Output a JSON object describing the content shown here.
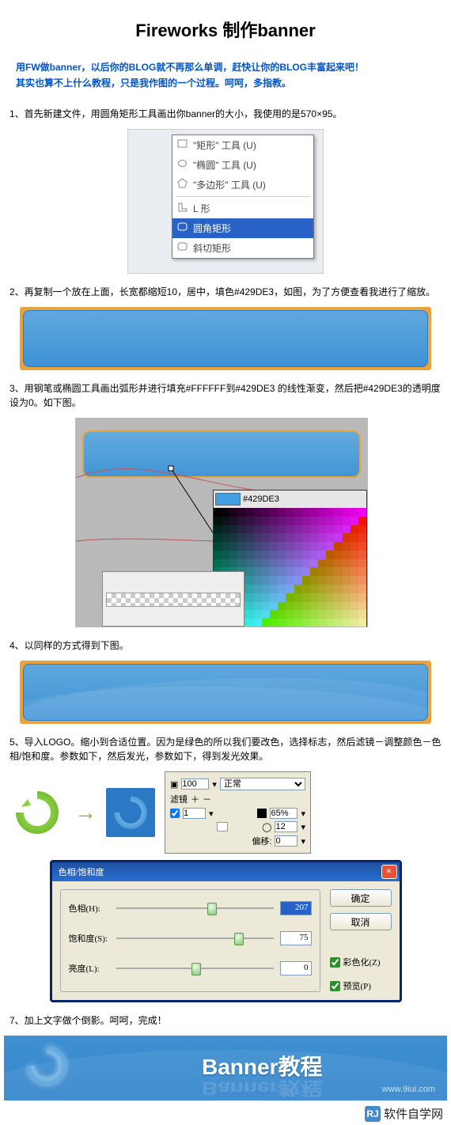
{
  "title": "Fireworks 制作banner",
  "intro": {
    "line1": "用FW做banner，以后你的BLOG就不再那么单调，赶快让你的BLOG丰富起来吧！",
    "line2": "其实也算不上什么教程，只是我作图的一个过程。呵呵，多指教。"
  },
  "steps": {
    "s1": "1、首先新建文件，用圆角矩形工具画出你banner的大小，我使用的是570×95。",
    "s2": "2、再复制一个放在上面，长宽都缩短10，居中，填色#429DE3，如图，为了方便查看我进行了缩放。",
    "s3": "3、用钢笔或椭圆工具画出弧形并进行填充#FFFFFF到#429DE3 的线性渐变，然后把#429DE3的透明度设为0。如下图。",
    "s4": "4、以同样的方式得到下图。",
    "s5": "5、导入LOGO。缩小到合适位置。因为是绿色的所以我们要改色，选择标志，然后滤镜－调整颜色－色相/饱和度。参数如下，然后发光，参数如下，得到发光效果。",
    "s7": "7、加上文字做个倒影。呵呵，完成！"
  },
  "menu": {
    "m1": "\"矩形\" 工具  (U)",
    "m2": "\"椭圆\" 工具  (U)",
    "m3": "\"多边形\" 工具  (U)",
    "m4": "L 形",
    "m5": "圆角矩形",
    "m6": "斜切矩形"
  },
  "hexcolor": "#429DE3",
  "panel5": {
    "opacity": "100",
    "blend": "正常",
    "filter_label": "滤镜",
    "v1": "1",
    "v65": "65%",
    "v12": "12",
    "offset_label": "偏移:",
    "offset": "0"
  },
  "dialog": {
    "title": "色相/饱和度",
    "hue_label": "色相(H):",
    "hue": "207",
    "sat_label": "饱和度(S):",
    "sat": "75",
    "light_label": "亮度(L):",
    "light": "0",
    "ok": "确定",
    "cancel": "取消",
    "colorize": "彩色化(Z)",
    "preview": "预览(P)"
  },
  "finalbanner": {
    "text": "Banner教程",
    "url": "www.9iui.com"
  },
  "footer": {
    "logo": "RJ",
    "text": "软件自学网"
  },
  "colors": {
    "accent": "#429DE3"
  }
}
